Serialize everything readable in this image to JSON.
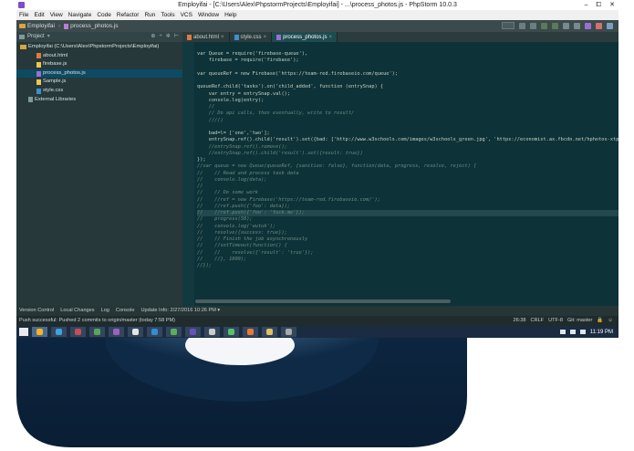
{
  "window": {
    "title": "Employifai - [C:\\Users\\Alex\\PhpstormProjects\\Employifai] - ...\\process_photos.js - PhpStorm 10.0.3",
    "controls": [
      "–",
      "⧠",
      "✕"
    ]
  },
  "menu": [
    "File",
    "Edit",
    "View",
    "Navigate",
    "Code",
    "Refactor",
    "Run",
    "Tools",
    "VCS",
    "Window",
    "Help"
  ],
  "navbar": {
    "project": "Employifai",
    "file": "process_photos.js"
  },
  "sidebar": {
    "header": "Project",
    "tree": [
      {
        "label": "Employifai (C:\\Users\\Alex\\PhpstormProjects\\Employifai)",
        "icon": "folder-icon",
        "indent": 0
      },
      {
        "label": "about.html",
        "icon": "html-file-icon",
        "indent": 2
      },
      {
        "label": "firebase.js",
        "icon": "js-file-icon",
        "indent": 2
      },
      {
        "label": "process_photos.js",
        "icon": "php-file-icon",
        "indent": 2,
        "selected": true
      },
      {
        "label": "Sample.js",
        "icon": "js-file-icon",
        "indent": 2
      },
      {
        "label": "style.css",
        "icon": "css-file-icon",
        "indent": 2
      },
      {
        "label": "External Libraries",
        "icon": "library-icon",
        "indent": 1
      }
    ]
  },
  "tabs": [
    {
      "label": "about.html",
      "icon": "html-file-icon",
      "active": false
    },
    {
      "label": "style.css",
      "icon": "css-file-icon",
      "active": false
    },
    {
      "label": "process_photos.js",
      "icon": "php-file-icon",
      "active": true
    }
  ],
  "code_lines": [
    {
      "kind": "def",
      "text": "var Queue = require('firebase-queue'),"
    },
    {
      "kind": "def",
      "text": "    firebase = require('firebase');"
    },
    {
      "kind": "def",
      "text": ""
    },
    {
      "kind": "def",
      "text": "var queueRef = new Firebase('https://team-red.firebaseio.com/queue');"
    },
    {
      "kind": "def",
      "text": ""
    },
    {
      "kind": "def",
      "text": "queueRef.child('tasks').on('child_added', function (entrySnap) {"
    },
    {
      "kind": "def",
      "text": "    var entry = entrySnap.val();"
    },
    {
      "kind": "def",
      "text": "    console.log(entry);"
    },
    {
      "kind": "cmt",
      "text": "    //"
    },
    {
      "kind": "cmt",
      "text": "    // Do api calls, then eventually, write to result/"
    },
    {
      "kind": "cmt",
      "text": "    ///()"
    },
    {
      "kind": "def",
      "text": ""
    },
    {
      "kind": "def",
      "text": "    bad=l= ['one','two'];"
    },
    {
      "kind": "def",
      "text": "    entrySnap.ref().child('result').set({bad: ['http://www.w3schools.com/images/w3schools_green.jpg', 'https://economist.ax.fbcdn.net/hphotos-xtp1/v/t1.0-9/1"
    },
    {
      "kind": "cmt",
      "text": "    //entrySnap.ref().remove();"
    },
    {
      "kind": "cmt",
      "text": "    //entrySnap.ref().child('result').set({result: true})"
    },
    {
      "kind": "def",
      "text": "});"
    },
    {
      "kind": "cmt",
      "text": "//var queue = new Queue(queueRef, {sanitize: false}, function(data, progress, resolve, reject) {"
    },
    {
      "kind": "cmt",
      "text": "//    // Read and process task data"
    },
    {
      "kind": "cmt",
      "text": "//    console.log(data);"
    },
    {
      "kind": "cmt",
      "text": "//"
    },
    {
      "kind": "cmt",
      "text": "//    // Do some work"
    },
    {
      "kind": "cmt",
      "text": "//    //ref = new Firebase('https://team-red.firebaseio.com/');"
    },
    {
      "kind": "cmt",
      "text": "//    //ref.push({'foo': data});"
    },
    {
      "kind": "cmt",
      "text": "//    //ref.push({'foo': 'fuck.me'});",
      "highlight": true
    },
    {
      "kind": "cmt",
      "text": "//    progress(50);"
    },
    {
      "kind": "cmt",
      "text": "//    console.log('wutuk');"
    },
    {
      "kind": "cmt",
      "text": "//    resolve({success: true});"
    },
    {
      "kind": "cmt",
      "text": "//    // Finish the job asynchronously"
    },
    {
      "kind": "cmt",
      "text": "//    //setTimeout(function() {"
    },
    {
      "kind": "cmt",
      "text": "//    //    resolve({'result': 'true'});"
    },
    {
      "kind": "cmt",
      "text": "//    //}, 1000);"
    },
    {
      "kind": "cmt",
      "text": "//});"
    }
  ],
  "toolwindows": [
    "Version Control",
    "Local Changes",
    "Log",
    "Console",
    "Update Info: 2/27/2016 10:26 PM ▾"
  ],
  "status": {
    "message": "Push successful: Pushed 2 commits to origin/master (today 7:58 PM)",
    "position": "26:38",
    "line_sep": "CRLF",
    "encoding": "UTF-8",
    "git": "Git: master"
  },
  "taskbar": {
    "time": "11:19 PM",
    "colors": [
      "#ffb21c",
      "#3aa3e3",
      "#c44d58",
      "#5aa55a",
      "#9f60c0",
      "#e5e5e5",
      "#2f8fd7",
      "#5ab05a",
      "#6b4fbb",
      "#cccccc",
      "#5ac06c",
      "#e87933",
      "#e0c060",
      "#aaaaaa"
    ]
  }
}
